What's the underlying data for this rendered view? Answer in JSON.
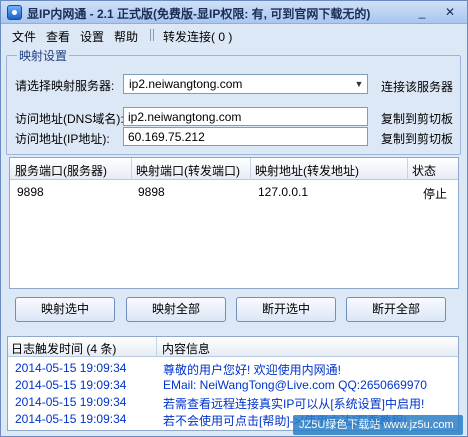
{
  "window": {
    "title": "显IP内网通 - 2.1 正式版(免费版-显IP权限: 有, 可到官网下载无的)",
    "min": "_",
    "close": "✕"
  },
  "menu": {
    "file": "文件",
    "view": "查看",
    "settings": "设置",
    "help": "帮助",
    "relay": "转发连接( 0 )"
  },
  "mapping": {
    "group_title": "映射设置",
    "server_label": "请选择映射服务器:",
    "server_value": "ip2.neiwangtong.com",
    "connect_label": "连接该服务器",
    "dns_label": "访问地址(DNS域名):",
    "dns_value": "ip2.neiwangtong.com",
    "ip_label": "访问地址(IP地址):",
    "ip_value": "60.169.75.212",
    "copy1": "复制到剪切板",
    "copy2": "复制到剪切板"
  },
  "table": {
    "headers": [
      "服务端口(服务器)",
      "映射端口(转发端口)",
      "映射地址(转发地址)",
      "状态"
    ],
    "rows": [
      [
        "9898",
        "9898",
        "127.0.0.1",
        "停止"
      ]
    ]
  },
  "buttons": {
    "map_selected": "映射选中",
    "map_all": "映射全部",
    "disconnect_selected": "断开选中",
    "disconnect_all": "断开全部"
  },
  "log": {
    "col_time": "日志触发时间 (4 条)",
    "col_info": "内容信息",
    "rows": [
      {
        "time": "2014-05-15 19:09:34",
        "info": "尊敬的用户您好! 欢迎使用内网通!"
      },
      {
        "time": "2014-05-15 19:09:34",
        "info": "EMail: NeiWangTong@Live.com QQ:2650669970"
      },
      {
        "time": "2014-05-15 19:09:34",
        "info": "若需查看远程连接真实IP可以从[系统设置]中启用!"
      },
      {
        "time": "2014-05-15 19:09:34",
        "info": "若不会使用可点击[帮助]->[使用方法]观看教程!"
      }
    ]
  },
  "watermark": "JZ5U绿色下载站 www.jz5u.com"
}
